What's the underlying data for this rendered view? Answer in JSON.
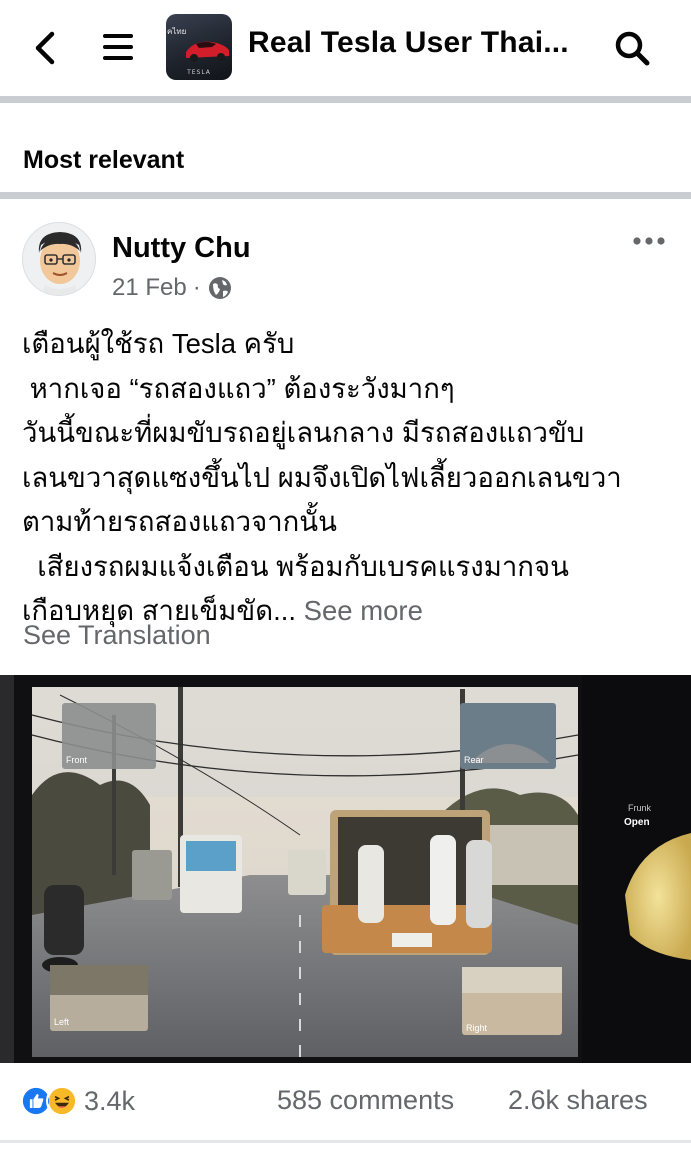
{
  "header": {
    "group_name": "Real Tesla User Thai...",
    "thumb_text_top": "คไทย",
    "thumb_brand": "TESLA",
    "back_icon": "chevron-left-icon",
    "menu_icon": "hamburger-menu-icon",
    "search_icon": "search-icon"
  },
  "sort": {
    "label": "Most relevant"
  },
  "post": {
    "author": "Nutty Chu",
    "date": "21 Feb",
    "separator": "·",
    "privacy_icon": "globe-icon",
    "more_icon": "more-options-icon",
    "lines": [
      "เตือนผู้ใช้รถ Tesla ครับ",
      " หากเจอ “รถสองแถว” ต้องระวังมากๆ",
      "วันนี้ขณะที่ผมขับรถอยู่เลนกลาง มีรถสองแถวขับ",
      "เลนขวาสุดแซงขึ้นไป ผมจึงเปิดไฟเลี้ยวออกเลนขวา",
      "ตามท้ายรถสองแถวจากนั้น",
      "  เสียงรถผมแจ้งเตือน พร้อมกับเบรคแรงมากจน"
    ],
    "last_line": "เกือบหยุด สายเข็มขัด...",
    "see_more": "See more",
    "see_translation": "See Translation"
  },
  "media": {
    "camera_front": "Front",
    "camera_rear": "Rear",
    "camera_left": "Left",
    "camera_right": "Right",
    "frunk_label": "Frunk",
    "frunk_state": "Open"
  },
  "footer": {
    "reaction_icons": [
      "like-icon",
      "haha-icon"
    ],
    "reaction_count": "3.4k",
    "comments": "585 comments",
    "shares": "2.6k shares"
  },
  "colors": {
    "like_blue": "#1877f2",
    "haha_yellow": "#f7b928",
    "secondary_text": "#65676b",
    "separator": "#c9ccd1"
  }
}
